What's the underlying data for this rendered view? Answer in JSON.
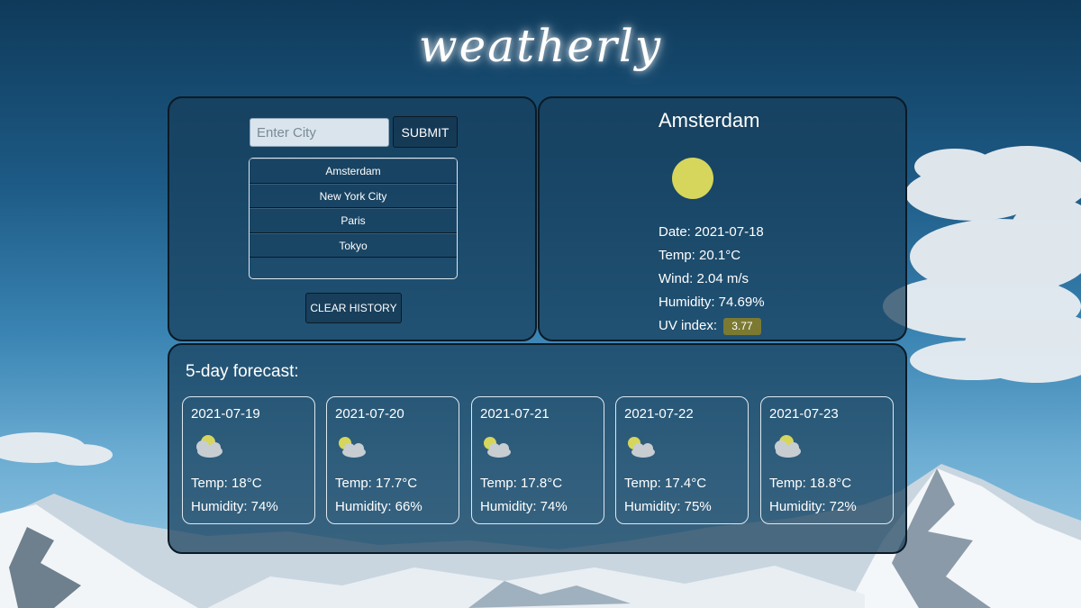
{
  "app": {
    "title": "weatherly"
  },
  "search": {
    "placeholder": "Enter City",
    "value": "",
    "submit_label": "SUBMIT",
    "history": [
      "Amsterdam",
      "New York City",
      "Paris",
      "Tokyo"
    ],
    "clear_label": "CLEAR HISTORY"
  },
  "current": {
    "city": "Amsterdam",
    "icon": "sun-icon",
    "date": "Date: 2021-07-18",
    "temp": "Temp: 20.1°C",
    "wind": "Wind: 2.04 m/s",
    "humidity": "Humidity: 74.69%",
    "uv_label": "UV index:",
    "uv_value": "3.77"
  },
  "forecast": {
    "heading": "5-day forecast:",
    "days": [
      {
        "date": "2021-07-19",
        "icon": "partly-cloudy-icon",
        "temp": "Temp: 18°C",
        "humidity": "Humidity: 74%"
      },
      {
        "date": "2021-07-20",
        "icon": "partly-cloudy-icon",
        "temp": "Temp: 17.7°C",
        "humidity": "Humidity: 66%"
      },
      {
        "date": "2021-07-21",
        "icon": "partly-cloudy-icon",
        "temp": "Temp: 17.8°C",
        "humidity": "Humidity: 74%"
      },
      {
        "date": "2021-07-22",
        "icon": "partly-cloudy-icon",
        "temp": "Temp: 17.4°C",
        "humidity": "Humidity: 75%"
      },
      {
        "date": "2021-07-23",
        "icon": "partly-cloudy-icon",
        "temp": "Temp: 18.8°C",
        "humidity": "Humidity: 72%"
      }
    ]
  },
  "colors": {
    "panel": "#183e5a",
    "panel_border": "#0b1a26",
    "sun": "#d6d65c",
    "uv_badge": "#7c7a32",
    "input_bg": "#d9e4ec"
  }
}
